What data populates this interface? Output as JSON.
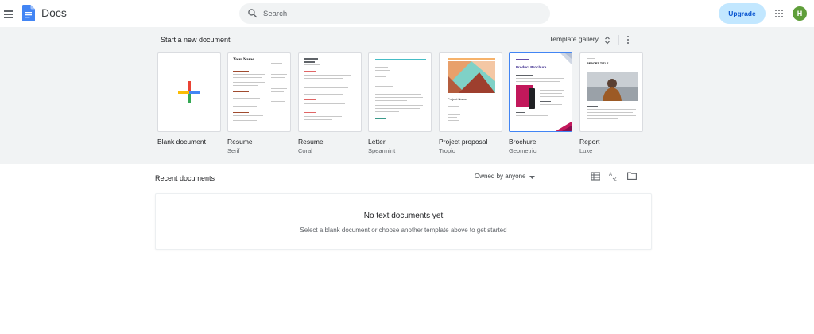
{
  "header": {
    "app_title": "Docs",
    "search_placeholder": "Search",
    "upgrade_label": "Upgrade",
    "avatar_initial": "H"
  },
  "templates": {
    "section_title": "Start a new document",
    "gallery_label": "Template gallery",
    "items": [
      {
        "name": "Blank document",
        "sub": ""
      },
      {
        "name": "Resume",
        "sub": "Serif"
      },
      {
        "name": "Resume",
        "sub": "Coral"
      },
      {
        "name": "Letter",
        "sub": "Spearmint"
      },
      {
        "name": "Project proposal",
        "sub": "Tropic"
      },
      {
        "name": "Brochure",
        "sub": "Geometric"
      },
      {
        "name": "Report",
        "sub": "Luxe"
      }
    ],
    "thumb_text": {
      "resume_name": "Your Name",
      "proposal_title": "Project Name",
      "brochure_title": "Product Brochure",
      "report_title": "REPORT TITLE"
    }
  },
  "recent": {
    "title": "Recent documents",
    "owned_filter": "Owned by anyone",
    "empty_title": "No text documents yet",
    "empty_sub": "Select a blank document or choose another template above to get started"
  },
  "colors": {
    "accent": "#0b57d0",
    "upgrade_bg": "#c2e7ff",
    "panel_bg": "#f1f3f4",
    "avatar": "#5f9e3a",
    "docs_blue": "#4285f4"
  }
}
